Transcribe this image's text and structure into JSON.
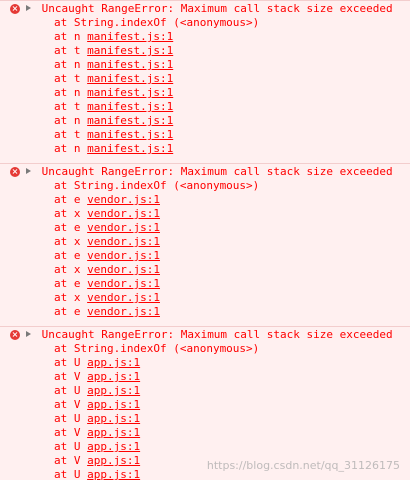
{
  "console": {
    "watermark": "https://blog.csdn.net/qq_31126175",
    "entries": [
      {
        "message": "Uncaught RangeError: Maximum call stack size exceeded",
        "first_frame": "at String.indexOf (<anonymous>)",
        "frames": [
          {
            "prefix": "at n ",
            "link": "manifest.js:1"
          },
          {
            "prefix": "at t ",
            "link": "manifest.js:1"
          },
          {
            "prefix": "at n ",
            "link": "manifest.js:1"
          },
          {
            "prefix": "at t ",
            "link": "manifest.js:1"
          },
          {
            "prefix": "at n ",
            "link": "manifest.js:1"
          },
          {
            "prefix": "at t ",
            "link": "manifest.js:1"
          },
          {
            "prefix": "at n ",
            "link": "manifest.js:1"
          },
          {
            "prefix": "at t ",
            "link": "manifest.js:1"
          },
          {
            "prefix": "at n ",
            "link": "manifest.js:1"
          }
        ]
      },
      {
        "message": "Uncaught RangeError: Maximum call stack size exceeded",
        "first_frame": "at String.indexOf (<anonymous>)",
        "frames": [
          {
            "prefix": "at e ",
            "link": "vendor.js:1"
          },
          {
            "prefix": "at x ",
            "link": "vendor.js:1"
          },
          {
            "prefix": "at e ",
            "link": "vendor.js:1"
          },
          {
            "prefix": "at x ",
            "link": "vendor.js:1"
          },
          {
            "prefix": "at e ",
            "link": "vendor.js:1"
          },
          {
            "prefix": "at x ",
            "link": "vendor.js:1"
          },
          {
            "prefix": "at e ",
            "link": "vendor.js:1"
          },
          {
            "prefix": "at x ",
            "link": "vendor.js:1"
          },
          {
            "prefix": "at e ",
            "link": "vendor.js:1"
          }
        ]
      },
      {
        "message": "Uncaught RangeError: Maximum call stack size exceeded",
        "first_frame": "at String.indexOf (<anonymous>)",
        "frames": [
          {
            "prefix": "at U ",
            "link": "app.js:1"
          },
          {
            "prefix": "at V ",
            "link": "app.js:1"
          },
          {
            "prefix": "at U ",
            "link": "app.js:1"
          },
          {
            "prefix": "at V ",
            "link": "app.js:1"
          },
          {
            "prefix": "at U ",
            "link": "app.js:1"
          },
          {
            "prefix": "at V ",
            "link": "app.js:1"
          },
          {
            "prefix": "at U ",
            "link": "app.js:1"
          },
          {
            "prefix": "at V ",
            "link": "app.js:1"
          },
          {
            "prefix": "at U ",
            "link": "app.js:1"
          }
        ]
      }
    ]
  }
}
